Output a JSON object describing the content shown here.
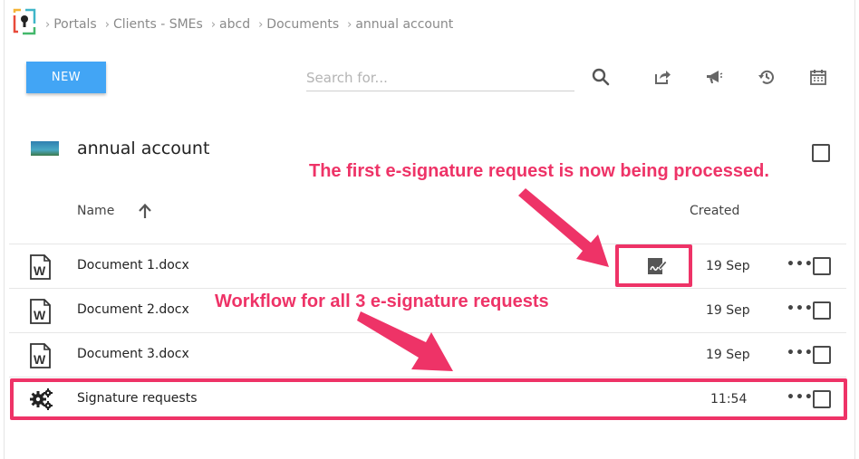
{
  "breadcrumb": {
    "items": [
      "Portals",
      "Clients - SMEs",
      "abcd",
      "Documents",
      "annual account"
    ],
    "separator": "›"
  },
  "toolbar": {
    "new_label": "NEW",
    "search_placeholder": "Search for...",
    "icons": [
      "search-icon",
      "share-icon",
      "announce-icon",
      "history-icon",
      "calendar-icon"
    ]
  },
  "folder": {
    "title": "annual account"
  },
  "columns": {
    "name": "Name",
    "created": "Created"
  },
  "rows": [
    {
      "name": "Document 1.docx",
      "created": "19 Sep",
      "more": "•••",
      "icon": "word-doc-icon",
      "status_icon": "e-signature-icon"
    },
    {
      "name": "Document 2.docx",
      "created": "19 Sep",
      "more": "•••",
      "icon": "word-doc-icon"
    },
    {
      "name": "Document 3.docx",
      "created": "19 Sep",
      "more": "•••",
      "icon": "word-doc-icon"
    },
    {
      "name": "Signature requests",
      "created": "11:54",
      "more": "•••",
      "icon": "gears-icon"
    }
  ],
  "annotations": {
    "first": "The first e-signature request is now being processed.",
    "second": "Workflow for all 3 e-signature requests"
  },
  "colors": {
    "accent": "#42a5f5",
    "annotation": "#ee3367"
  }
}
